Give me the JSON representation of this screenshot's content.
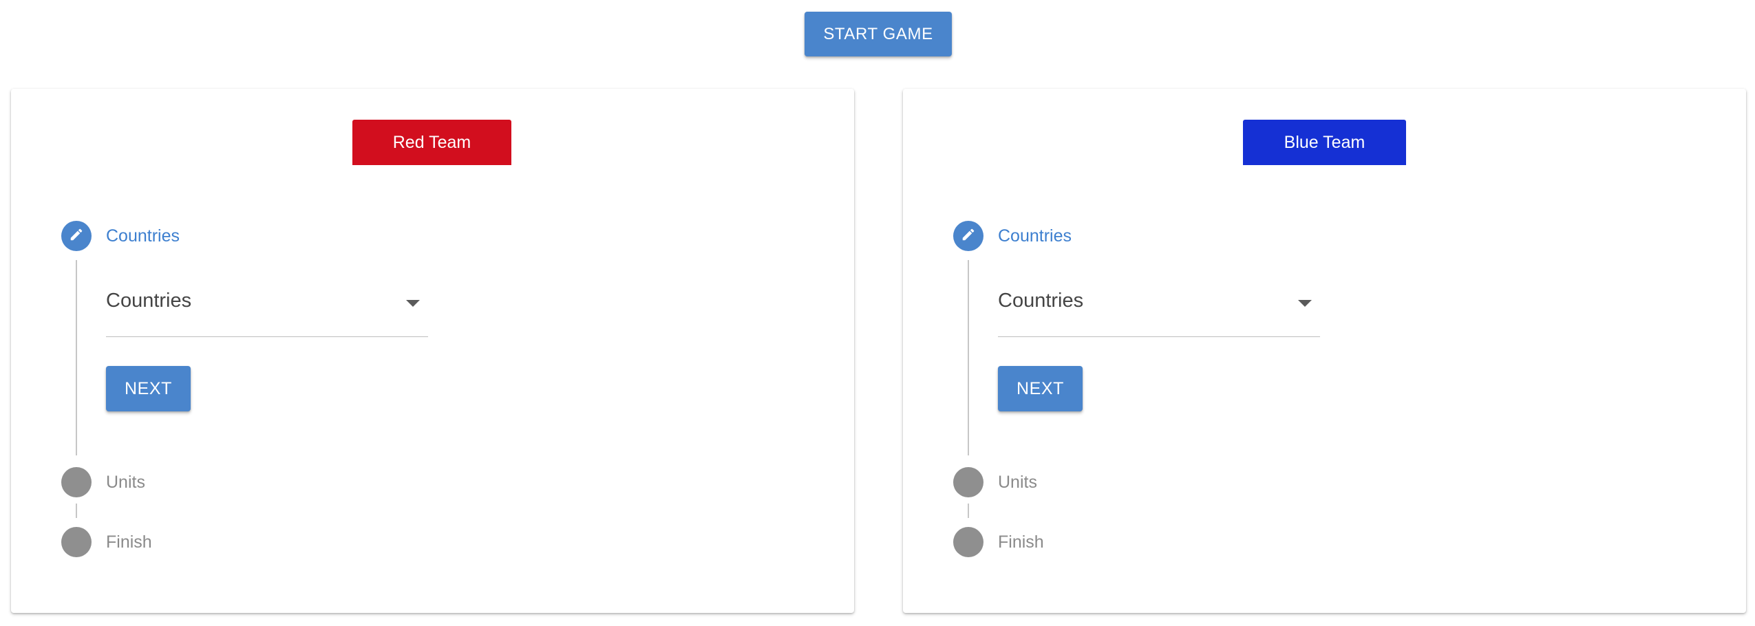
{
  "start_button": {
    "label": "START GAME"
  },
  "colors": {
    "accent": "#4a85cc",
    "step_inactive": "#8f8f8f"
  },
  "teams": [
    {
      "name": "Red Team",
      "color": "#d20e1e",
      "steps": [
        {
          "label": "Countries",
          "state": "active",
          "icon": "pencil-icon"
        },
        {
          "label": "Units",
          "state": "inactive"
        },
        {
          "label": "Finish",
          "state": "inactive"
        }
      ],
      "select": {
        "value": "Countries"
      },
      "next_label": "NEXT"
    },
    {
      "name": "Blue Team",
      "color": "#1530d4",
      "steps": [
        {
          "label": "Countries",
          "state": "active",
          "icon": "pencil-icon"
        },
        {
          "label": "Units",
          "state": "inactive"
        },
        {
          "label": "Finish",
          "state": "inactive"
        }
      ],
      "select": {
        "value": "Countries"
      },
      "next_label": "NEXT"
    }
  ]
}
